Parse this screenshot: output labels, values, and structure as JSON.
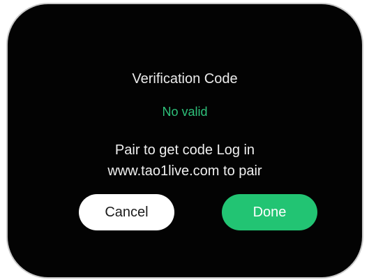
{
  "dialog": {
    "title": "Verification Code",
    "status": "No valid",
    "message_line1": "Pair to get code Log in",
    "message_line2": "www.tao1live.com to pair",
    "cancel_label": "Cancel",
    "done_label": "Done"
  },
  "colors": {
    "background": "#030303",
    "status_green": "#2ec07a",
    "done_button": "#22c473",
    "cancel_button": "#ffffff"
  }
}
